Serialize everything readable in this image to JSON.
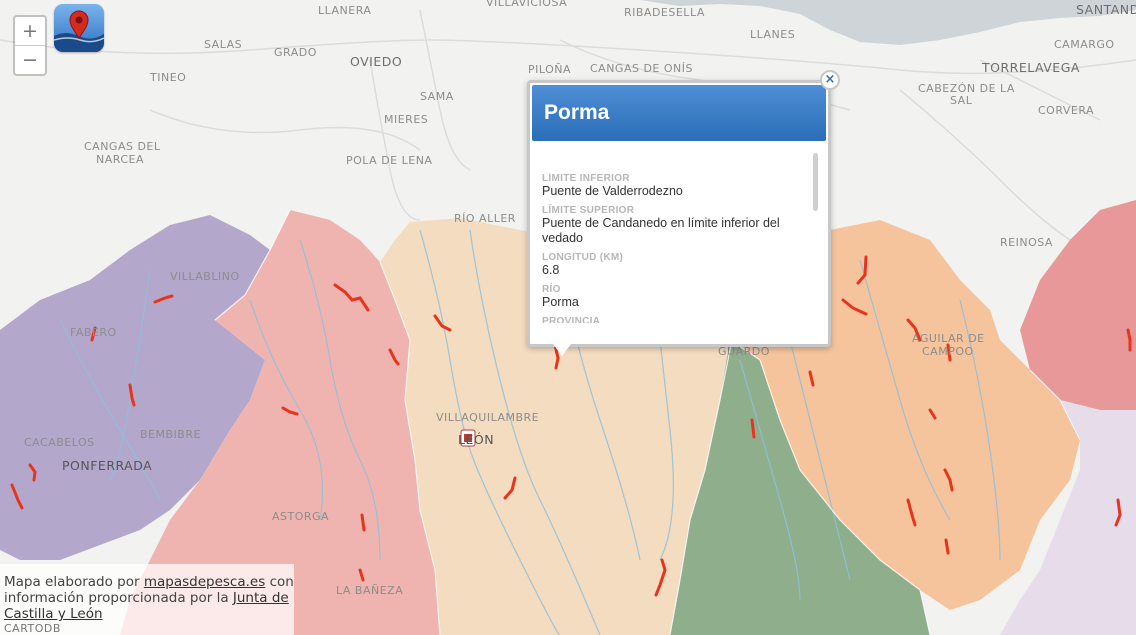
{
  "map": {
    "zoom_in_label": "+",
    "zoom_out_label": "−",
    "places": [
      {
        "name": "LLANERA",
        "cls": "place"
      },
      {
        "name": "VILLAVICIOSA",
        "cls": "place"
      },
      {
        "name": "RIBADESELLA",
        "cls": "place"
      },
      {
        "name": "SANTANDER",
        "cls": "place big"
      },
      {
        "name": "SALAS",
        "cls": "place"
      },
      {
        "name": "GRADO",
        "cls": "place"
      },
      {
        "name": "OVIEDO",
        "cls": "place big"
      },
      {
        "name": "LLANES",
        "cls": "place"
      },
      {
        "name": "CAMARGO",
        "cls": "place"
      },
      {
        "name": "PILOÑA",
        "cls": "place"
      },
      {
        "name": "CANGAS DE ONÍS",
        "cls": "place"
      },
      {
        "name": "TORRELAVEGA",
        "cls": "place big"
      },
      {
        "name": "TINEO",
        "cls": "place"
      },
      {
        "name": "SAMA",
        "cls": "place"
      },
      {
        "name": "CABEZÓN DE LA",
        "cls": "place"
      },
      {
        "name": "SAL",
        "cls": "place"
      },
      {
        "name": "MIERES",
        "cls": "place"
      },
      {
        "name": "CORVERA",
        "cls": "place"
      },
      {
        "name": "CANGAS DEL",
        "cls": "place"
      },
      {
        "name": "NARCEA",
        "cls": "place"
      },
      {
        "name": "POLA DE LENA",
        "cls": "place"
      },
      {
        "name": "RÍO ALLER",
        "cls": "place"
      },
      {
        "name": "REINOSA",
        "cls": "place"
      },
      {
        "name": "VILLABLINO",
        "cls": "place"
      },
      {
        "name": "FABERO",
        "cls": "place"
      },
      {
        "name": "AGUILAR DE",
        "cls": "place"
      },
      {
        "name": "CAMPOO",
        "cls": "place"
      },
      {
        "name": "GUARDO",
        "cls": "place"
      },
      {
        "name": "VILLAQUILAMBRE",
        "cls": "place"
      },
      {
        "name": "CACABELOS",
        "cls": "place"
      },
      {
        "name": "BEMBIBRE",
        "cls": "place"
      },
      {
        "name": "LEÓN",
        "cls": "place city"
      },
      {
        "name": "PONFERRADA",
        "cls": "place city"
      },
      {
        "name": "ASTORGA",
        "cls": "place"
      },
      {
        "name": "LA BAÑEZA",
        "cls": "place"
      }
    ],
    "colors": {
      "water": "#cfd4d8",
      "land": "#f2f2f0",
      "purple": "#b3a8cc",
      "pink": "#f0b4b0",
      "beige": "#f4dcc0",
      "green": "#8fae8c",
      "orange": "#f5c49c",
      "redzone": "#e89898",
      "lavender": "#e6dcea",
      "river": "#8ec0dc",
      "vedado": "#e8341c"
    }
  },
  "popup": {
    "title": "Porma",
    "close_label": "×",
    "fields": [
      {
        "label": "LÍMITE INFERIOR",
        "value": "Puente de Valderrodezno"
      },
      {
        "label": "LÍMITE SUPERIOR",
        "value": "Puente de Candanedo en límite inferior del vedado"
      },
      {
        "label": "LONGITUD (KM)",
        "value": "6.8"
      },
      {
        "label": "RÍO",
        "value": "Porma"
      },
      {
        "label": "PROVINCIA",
        "value": ""
      }
    ]
  },
  "attribution": {
    "prefix": "Mapa elaborado por",
    "link1": "mapasdepesca.es",
    "middle": "con información proporcionada por la",
    "link2": "Junta de Castilla y León",
    "cartodb": "CARTODB"
  }
}
